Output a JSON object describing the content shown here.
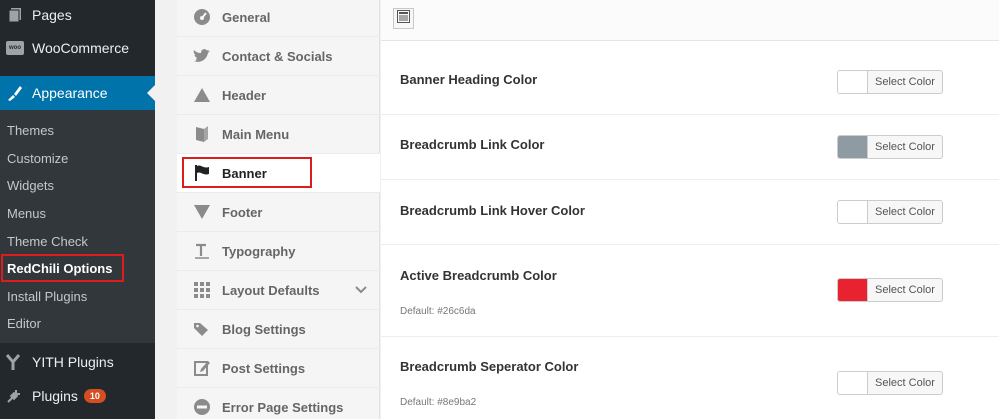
{
  "wp_menu": {
    "pages": "Pages",
    "woocommerce": "WooCommerce",
    "woo_badge": "woo",
    "appearance": "Appearance",
    "submenu": [
      "Themes",
      "Customize",
      "Widgets",
      "Menus",
      "Theme Check",
      "RedChili Options",
      "Install Plugins",
      "Editor"
    ],
    "yith": "YITH Plugins",
    "plugins": "Plugins",
    "plugins_count": "10"
  },
  "options_nav": {
    "items": [
      {
        "label": "General",
        "icon": "dashboard-icon"
      },
      {
        "label": "Contact & Socials",
        "icon": "twitter-icon"
      },
      {
        "label": "Header",
        "icon": "triangle-up-icon"
      },
      {
        "label": "Main Menu",
        "icon": "book-icon"
      },
      {
        "label": "Banner",
        "icon": "flag-icon"
      },
      {
        "label": "Footer",
        "icon": "triangle-down-icon"
      },
      {
        "label": "Typography",
        "icon": "text-icon"
      },
      {
        "label": "Layout Defaults",
        "icon": "grid-icon"
      },
      {
        "label": "Blog Settings",
        "icon": "tags-icon"
      },
      {
        "label": "Post Settings",
        "icon": "edit-icon"
      },
      {
        "label": "Error Page Settings",
        "icon": "no-entry-icon"
      }
    ]
  },
  "fields": [
    {
      "label": "Banner Heading Color",
      "default": "",
      "swatch": "#ffffff",
      "button": "Select Color"
    },
    {
      "label": "Breadcrumb Link Color",
      "default": "",
      "swatch": "#8e9ba2",
      "button": "Select Color"
    },
    {
      "label": "Breadcrumb Link Hover Color",
      "default": "",
      "swatch": "#ffffff",
      "button": "Select Color"
    },
    {
      "label": "Active Breadcrumb Color",
      "default": "Default: #26c6da",
      "swatch": "#e8232f",
      "button": "Select Color"
    },
    {
      "label": "Breadcrumb Seperator Color",
      "default": "Default: #8e9ba2",
      "swatch": "#ffffff",
      "button": "Select Color"
    }
  ],
  "colors": {
    "wp_sidebar": "#23282d",
    "wp_active": "#0073aa",
    "highlight": "#dd1d1d"
  }
}
